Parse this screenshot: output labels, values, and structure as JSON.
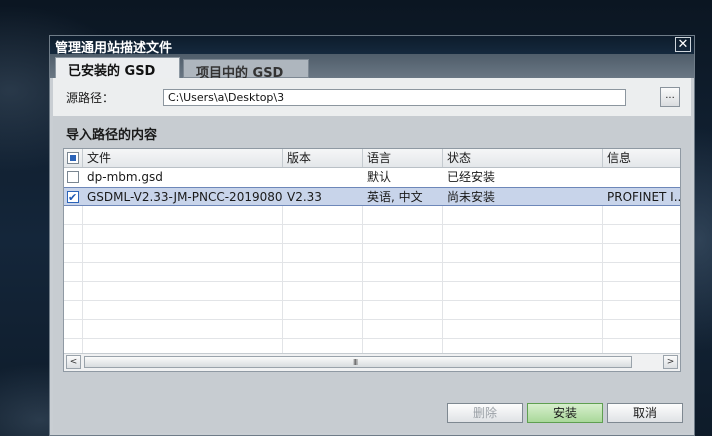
{
  "dialog": {
    "title": "管理通用站描述文件",
    "close_glyph": "✕"
  },
  "tabs": [
    {
      "label": "已安装的 GSD",
      "active": true
    },
    {
      "label": "项目中的 GSD",
      "active": false
    }
  ],
  "source": {
    "label": "源路径：",
    "path": "C:\\Users\\a\\Desktop\\3",
    "browse_label": "..."
  },
  "section_title": "导入路径的内容",
  "table": {
    "columns": [
      "文件",
      "版本",
      "语言",
      "状态",
      "信息"
    ],
    "rows": [
      {
        "checked": false,
        "file": "dp-mbm.gsd",
        "version": "",
        "language": "默认",
        "status": "已经安装",
        "info": ""
      },
      {
        "checked": true,
        "file": "GSDML-V2.33-JM-PNCC-2019080...",
        "version": "V2.33",
        "language": "英语, 中文",
        "status": "尚未安装",
        "info": "PROFINET I..."
      }
    ]
  },
  "scrollbar": {
    "left_arrow": "<",
    "right_arrow": ">",
    "grip": "III"
  },
  "buttons": {
    "delete": "删除",
    "install": "安装",
    "cancel": "取消"
  },
  "colors": {
    "selected_row": "#c8d4ea",
    "install_button": "#a9d89a",
    "titlebar": "#0d1c2c"
  }
}
